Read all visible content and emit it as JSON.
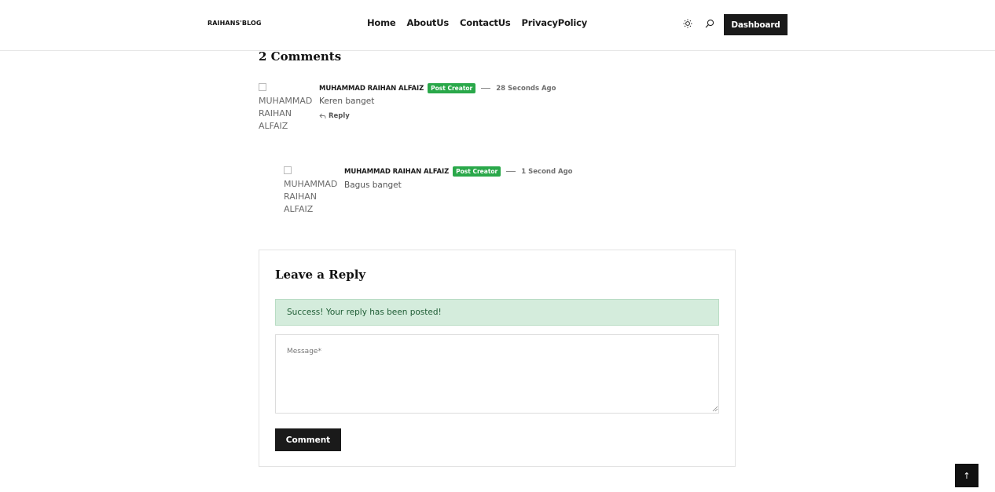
{
  "header": {
    "brand": "RAIHANS'BLOG",
    "nav": [
      "Home",
      "AboutUs",
      "ContactUs",
      "PrivacyPolicy"
    ],
    "dashboard_label": "Dashboard",
    "icons": [
      "sun-icon",
      "search-icon"
    ]
  },
  "comments": {
    "title": "2 Comments",
    "items": [
      {
        "avatar_alt": "MUHAMMAD RAIHAN ALFAIZ",
        "author": "MUHAMMAD RAIHAN ALFAIZ",
        "badge": "Post Creator",
        "time": "28 Seconds Ago",
        "text": "Keren banget",
        "reply_label": "Reply"
      },
      {
        "avatar_alt": "MUHAMMAD RAIHAN ALFAIZ",
        "author": "MUHAMMAD RAIHAN ALFAIZ",
        "badge": "Post Creator",
        "time": "1 Second Ago",
        "text": "Bagus banget"
      }
    ]
  },
  "reply_form": {
    "title": "Leave a Reply",
    "success_message": "Success! Your reply has been posted!",
    "message_placeholder": "Message*",
    "message_value": "",
    "submit_label": "Comment"
  },
  "back_to_top": "↑",
  "colors": {
    "badge": "#2aa84a",
    "success_bg": "#d4ecdc",
    "button_dark": "#1a1a1a"
  }
}
